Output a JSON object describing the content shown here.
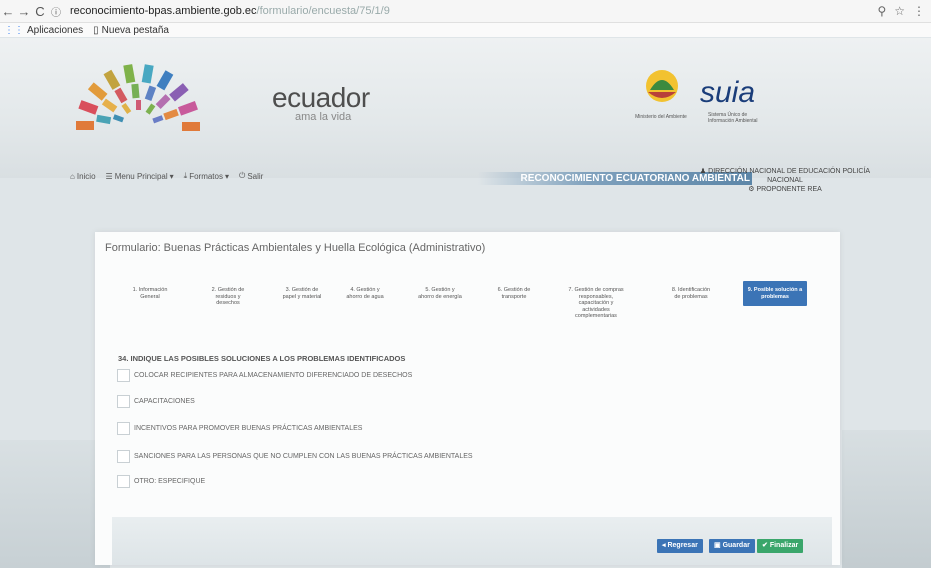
{
  "browser": {
    "url_host": "reconocimiento-bpas.ambiente.gob.ec",
    "url_path": "/formulario/encuesta/75/1/9",
    "bookmarks": [
      "Aplicaciones",
      "Nueva pestaña"
    ]
  },
  "header": {
    "ecuador": "ecuador",
    "tagline": "ama la vida",
    "ministry_text": "Ministerio del Ambiente",
    "suia": "suia",
    "suia_sub": "Sistema Único de Información Ambiental",
    "banner_title": "RECONOCIMIENTO ECUATORIANO AMBIENTAL"
  },
  "menu": {
    "items": [
      "Inicio",
      "Menu Principal",
      "Formatos",
      "Salir"
    ],
    "user_line1": "DIRECCIÓN NACIONAL DE EDUCACIÓN POLICÍA NACIONAL",
    "user_line2": "PROPONENTE REA"
  },
  "form": {
    "title": "Formulario: Buenas Prácticas Ambientales y Huella Ecológica (Administrativo)",
    "steps": [
      "1. Información General",
      "2. Gestión de residuos y desechos",
      "3. Gestión de papel y material",
      "4. Gestión y ahorro de agua",
      "5. Gestión y ahorro de energía",
      "6. Gestión de transporte",
      "7. Gestión de compras responsables, capacitación y actividades complementarias",
      "8. Identificación de problemas",
      "9. Posible solución a problemas"
    ],
    "question": "34. INDIQUE LAS POSIBLES SOLUCIONES A LOS PROBLEMAS IDENTIFICADOS",
    "options": [
      "COLOCAR RECIPIENTES PARA ALMACENAMIENTO DIFERENCIADO DE DESECHOS",
      "CAPACITACIONES",
      "INCENTIVOS PARA PROMOVER BUENAS PRÁCTICAS AMBIENTALES",
      "SANCIONES PARA LAS PERSONAS QUE NO CUMPLEN CON LAS BUENAS PRÁCTICAS AMBIENTALES",
      "OTRO: ESPECIFIQUE"
    ],
    "buttons": {
      "back": "Regresar",
      "save": "Guardar",
      "finish": "Finalizar"
    }
  }
}
